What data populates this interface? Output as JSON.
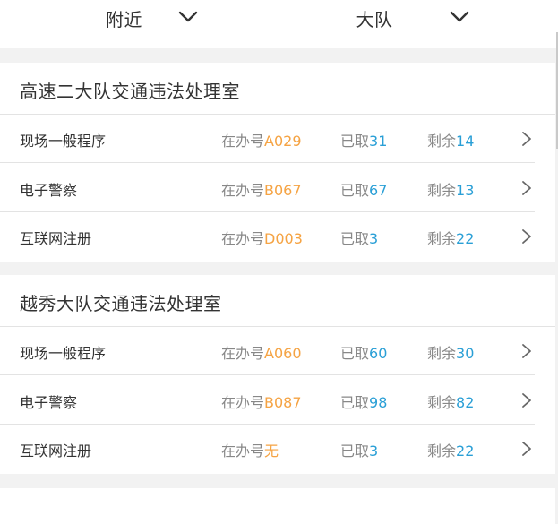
{
  "filters": {
    "nearby": {
      "label": "附近",
      "icon": "chevron-down-icon"
    },
    "brigade": {
      "label": "大队",
      "icon": "chevron-down-icon"
    }
  },
  "labels": {
    "current": "在办号",
    "taken": "已取",
    "remaining": "剩余"
  },
  "colors": {
    "accent_orange": "#f5a343",
    "accent_blue": "#2a9fd6",
    "divider": "#e3e3e3",
    "background": "#f2f2f2"
  },
  "offices": [
    {
      "name": "高速二大队交通违法处理室",
      "services": [
        {
          "name": "现场一般程序",
          "current": "A029",
          "taken": "31",
          "remaining": "14"
        },
        {
          "name": "电子警察",
          "current": "B067",
          "taken": "67",
          "remaining": "13"
        },
        {
          "name": "互联网注册",
          "current": "D003",
          "taken": "3",
          "remaining": "22"
        }
      ]
    },
    {
      "name": "越秀大队交通违法处理室",
      "services": [
        {
          "name": "现场一般程序",
          "current": "A060",
          "taken": "60",
          "remaining": "30"
        },
        {
          "name": "电子警察",
          "current": "B087",
          "taken": "98",
          "remaining": "82"
        },
        {
          "name": "互联网注册",
          "current": "无",
          "taken": "3",
          "remaining": "22"
        }
      ]
    }
  ]
}
